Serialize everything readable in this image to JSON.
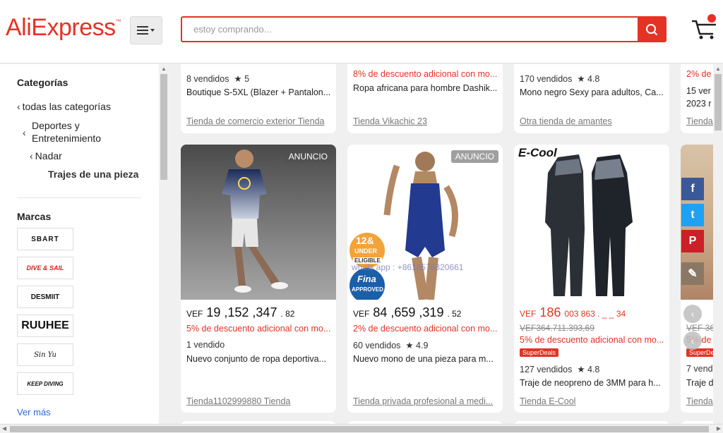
{
  "header": {
    "logo": "AliExpress",
    "search_placeholder": "estoy comprando..."
  },
  "sidebar": {
    "categories_title": "Categorías",
    "links": [
      {
        "label": "todas las categorías"
      },
      {
        "label": "Deportes y",
        "label2": "Entretenimiento"
      },
      {
        "label": "Nadar"
      }
    ],
    "current": "Trajes de una pieza",
    "brands_title": "Marcas",
    "brands": [
      "SBART",
      "DIVE & SAIL",
      "DESMIIT",
      "RUUHEE",
      "Sin Yu",
      "KEEP DIVING"
    ],
    "more": "Ver más"
  },
  "top_row": [
    {
      "sold": "8 vendidos",
      "rating": "5",
      "title": "Boutique S-5XL (Blazer + Pantalon...",
      "store": "Tienda de comercio exterior Tienda"
    },
    {
      "disc": "8% de descuento adicional con mo...",
      "title": "Ropa africana para hombre Dashik...",
      "store": "Tienda Vikachic 23"
    },
    {
      "sold": "170 vendidos",
      "rating": "4.8",
      "title": "Mono negro Sexy para adultos, Ca...",
      "store": "Otra tienda de amantes"
    },
    {
      "disc": "2% de",
      "title": "15 ver",
      "title2": "2023 r",
      "store": "Tienda"
    }
  ],
  "products": [
    {
      "badge": "ANUNCIO",
      "cur": "VEF",
      "price_main": "19 ,152 ,347",
      "price_dec": ". 82",
      "disc": "5% de descuento adicional con mo...",
      "sold": "1 vendido",
      "title": "Nuevo conjunto de ropa deportiva...",
      "store": "Tienda1102999880 Tienda"
    },
    {
      "badge": "ANUNCIO",
      "cur": "VEF",
      "price_main": "84 ,659 ,319",
      "price_dec": ". 52",
      "disc": "2% de descuento adicional con mo...",
      "sold": "60 vendidos",
      "rating": "4.9",
      "title": "Nuevo mono de una pieza para m...",
      "store": "Tienda privada profesional a medi...",
      "img_text1": "12&",
      "img_text2": "UNDER",
      "img_text3": "ELIGIBLE",
      "img_text4": "Fina",
      "img_text5": "APPROVED",
      "img_watermark": "whats app : +8618576320661"
    },
    {
      "brand_logo": "E-Cool",
      "cur": "VEF",
      "price_main": "186",
      "price_dec": "003 863 . _ _ 34",
      "old_price": "VEF364.711.393,69",
      "disc": "5% de descuento adicional con mo...",
      "superdeals": "SuperDeals",
      "sold": "127 vendidos",
      "rating": "4.8",
      "title": "Traje de neopreno de 3MM para h...",
      "store": "Tienda E-Cool"
    },
    {
      "old_price": "VEF 36",
      "disc": "5% de",
      "superdeals": "SuperDe",
      "sold": "7 vend",
      "title": "Traje d",
      "store": "Tienda"
    }
  ],
  "social": [
    {
      "glyph": "f",
      "color": "#3b5998"
    },
    {
      "glyph": "t",
      "color": "#1da1f2"
    },
    {
      "glyph": "P",
      "color": "#cb2027"
    },
    {
      "glyph": "✎",
      "color": "#8a7865"
    }
  ]
}
